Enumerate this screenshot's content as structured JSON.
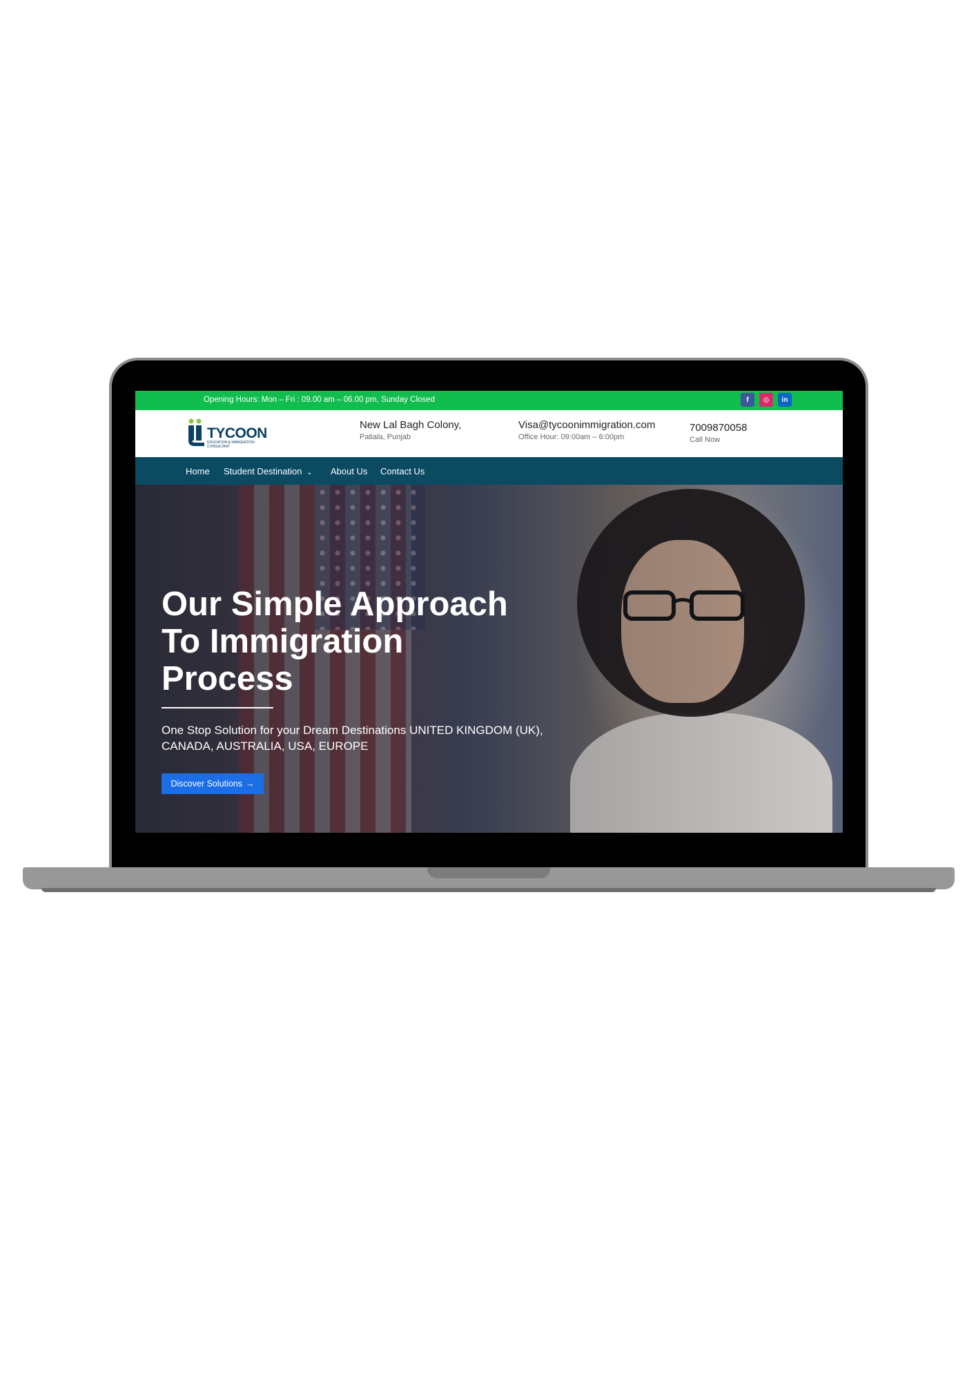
{
  "topbar": {
    "hours": "Opening Hours: Mon – Fri : 09.00 am – 06.00 pm, Sunday Closed",
    "social": [
      {
        "icon": "facebook-icon",
        "glyph": "f",
        "color": "#3b5998"
      },
      {
        "icon": "instagram-icon",
        "glyph": "◎",
        "color": "#d92b6a"
      },
      {
        "icon": "linkedin-icon",
        "glyph": "in",
        "color": "#0a66c2"
      }
    ]
  },
  "header": {
    "logo_text": "TYCOON",
    "logo_tagline": "EDUCATION & IMMIGRATION CONSULTANT",
    "address_line1": "New Lal Bagh Colony,",
    "address_line2": "Patiala, Punjab",
    "email": "Visa@tycoonimmigration.com",
    "office_hours": "Office Hour: 09:00am – 6:00pm",
    "phone": "7009870058",
    "phone_label": "Call Now"
  },
  "nav": {
    "items": [
      "Home",
      "Student Destination",
      "About Us",
      "Contact Us"
    ]
  },
  "hero": {
    "title_line1": "Our Simple Approach",
    "title_line2": "To Immigration",
    "title_line3": "Process",
    "subtitle": "One Stop Solution for your Dream Destinations UNITED KINGDOM (UK), CANADA, AUSTRALIA, USA, EUROPE",
    "button_label": "Discover Solutions",
    "button_arrow": "→"
  },
  "colors": {
    "topbar": "#11bd4e",
    "nav": "#0a4b62",
    "button": "#1b6ee6",
    "logo": "#0b3f63"
  }
}
